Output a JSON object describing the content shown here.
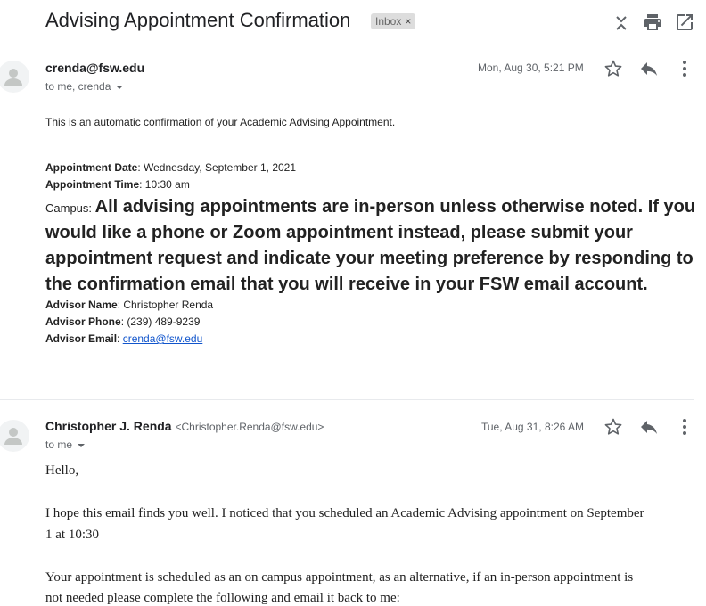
{
  "header": {
    "subject": "Advising Appointment Confirmation",
    "label_chip": "Inbox",
    "icons": [
      "expand-collapse-icon",
      "print-icon",
      "open-in-new-window-icon"
    ]
  },
  "message1": {
    "sender": "crenda@fsw.edu",
    "to": "to me, crenda",
    "date": "Mon, Aug 30, 5:21 PM",
    "intro": "This is an automatic confirmation of your Academic Advising Appointment.",
    "date_label": "Appointment Date",
    "date_value": ": Wednesday, September 1, 2021",
    "time_label": "Appointment Time",
    "time_value": ": 10:30 am",
    "campus_label": "Campus: ",
    "campus_value": "All advising appointments are in-person unless otherwise noted. If you would like a phone or Zoom appointment instead, please submit your appointment request and indicate your meeting preference by responding to the confirmation email that you will receive in your FSW email account.",
    "advisor_name_label": "Advisor Name",
    "advisor_name_value": ": Christopher Renda",
    "advisor_phone_label": "Advisor Phone",
    "advisor_phone_value": ": (239) 489-9239",
    "advisor_email_label": "Advisor Email",
    "advisor_email_sep": ": ",
    "advisor_email_value": "crenda@fsw.edu"
  },
  "message2": {
    "sender": "Christopher J. Renda",
    "sender_email": "<Christopher.Renda@fsw.edu>",
    "to": "to me",
    "date": "Tue, Aug 31, 8:26 AM",
    "greeting": "Hello,",
    "para1_line1": "I hope this email finds you well. I noticed that you scheduled an Academic Advising appointment on September",
    "para1_line2": "1 at 10:30",
    "para2_line1": "Your appointment is scheduled as an on campus appointment, as an alternative, if an in-person appointment is",
    "para2_line2": "not needed please complete the following and email it back to me:"
  },
  "colors": {
    "link": "#1155cc",
    "icon": "#5f6368",
    "chip_bg": "#dddddd"
  }
}
